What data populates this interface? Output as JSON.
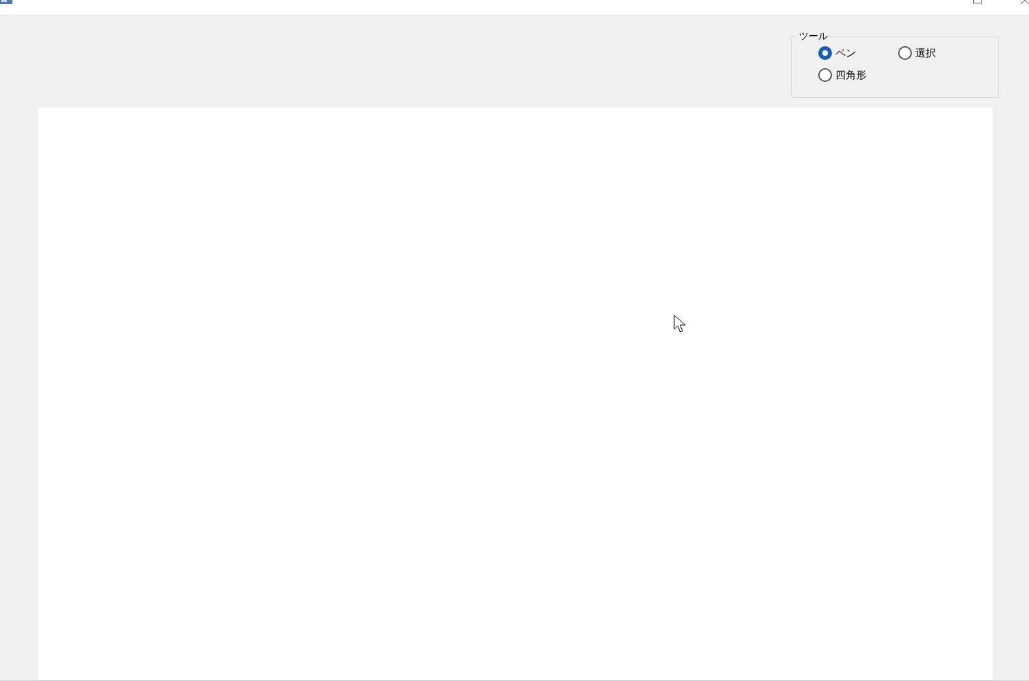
{
  "tool_group": {
    "title": "ツール",
    "options": [
      {
        "label": "ペン",
        "selected": true
      },
      {
        "label": "選択",
        "selected": false
      },
      {
        "label": "四角形",
        "selected": false
      }
    ]
  }
}
